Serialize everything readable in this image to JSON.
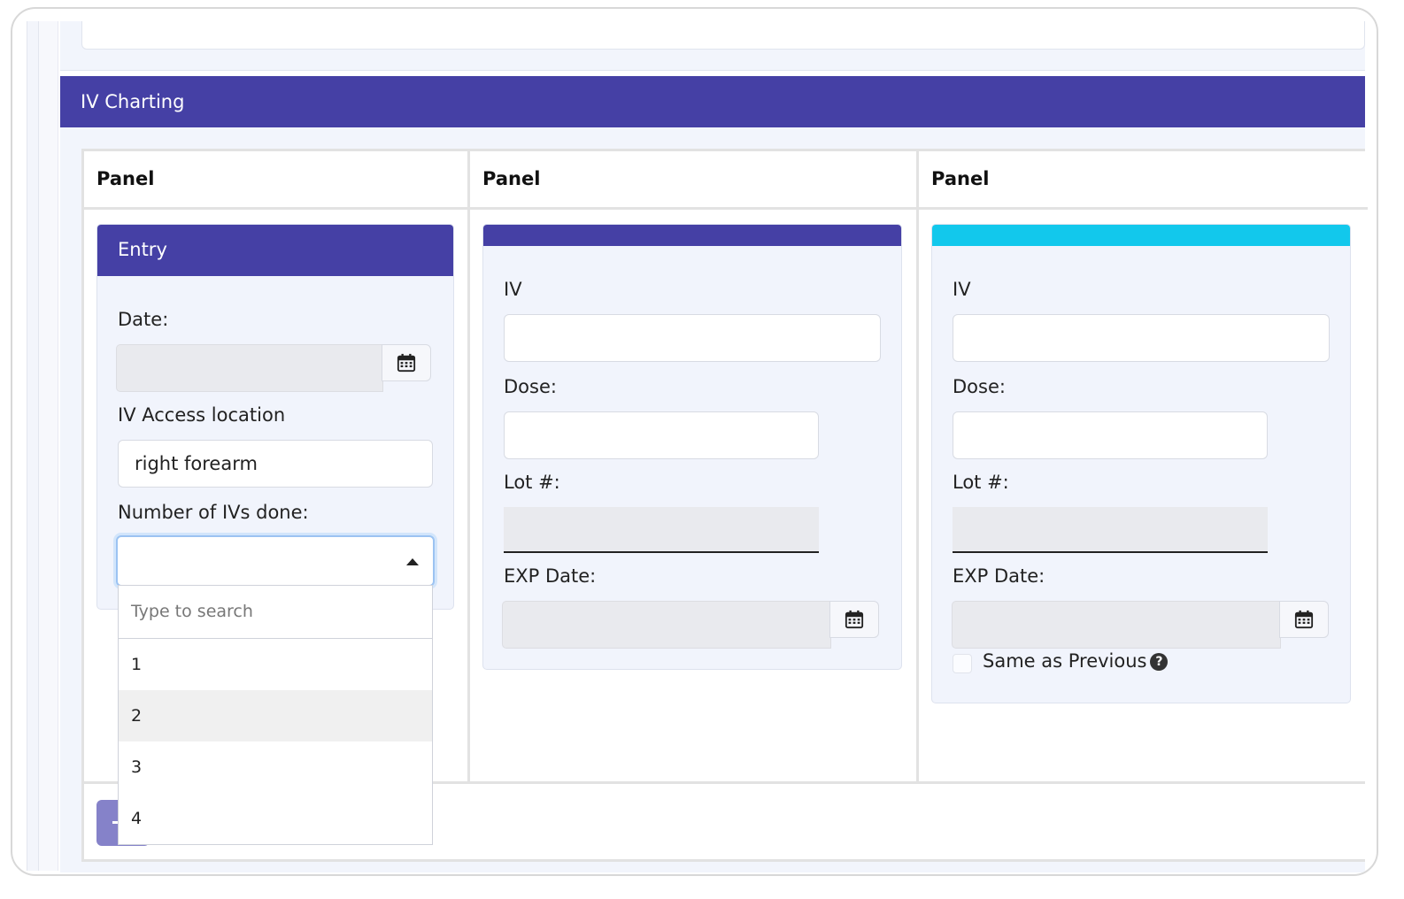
{
  "section": {
    "title": "IV Charting"
  },
  "columns": [
    {
      "header": "Panel"
    },
    {
      "header": "Panel"
    },
    {
      "header": "Panel"
    }
  ],
  "entry_card": {
    "title": "Entry",
    "date_label": "Date:",
    "date_value": "",
    "access_label": "IV Access location",
    "access_value": "right forearm",
    "number_label": "Number of IVs done:",
    "number_value": "",
    "dropdown": {
      "search_placeholder": "Type to search",
      "options": [
        "1",
        "2",
        "3",
        "4"
      ],
      "highlighted": "2"
    }
  },
  "iv_card_1": {
    "accent_color": "#4540a5",
    "iv_label": "IV",
    "iv_value": "",
    "dose_label": "Dose:",
    "dose_value": "",
    "lot_label": "Lot #:",
    "lot_value": "",
    "exp_label": "EXP Date:",
    "exp_value": ""
  },
  "iv_card_2": {
    "accent_color": "#12c8ec",
    "iv_label": "IV",
    "iv_value": "",
    "dose_label": "Dose:",
    "dose_value": "",
    "lot_label": "Lot #:",
    "lot_value": "",
    "exp_label": "EXP Date:",
    "exp_value": "",
    "same_as_previous_label": "Same as Previous",
    "same_as_previous_checked": false
  },
  "icons": {
    "calendar": "calendar-icon",
    "help": "question-circle-icon",
    "caret": "caret-up-icon"
  }
}
